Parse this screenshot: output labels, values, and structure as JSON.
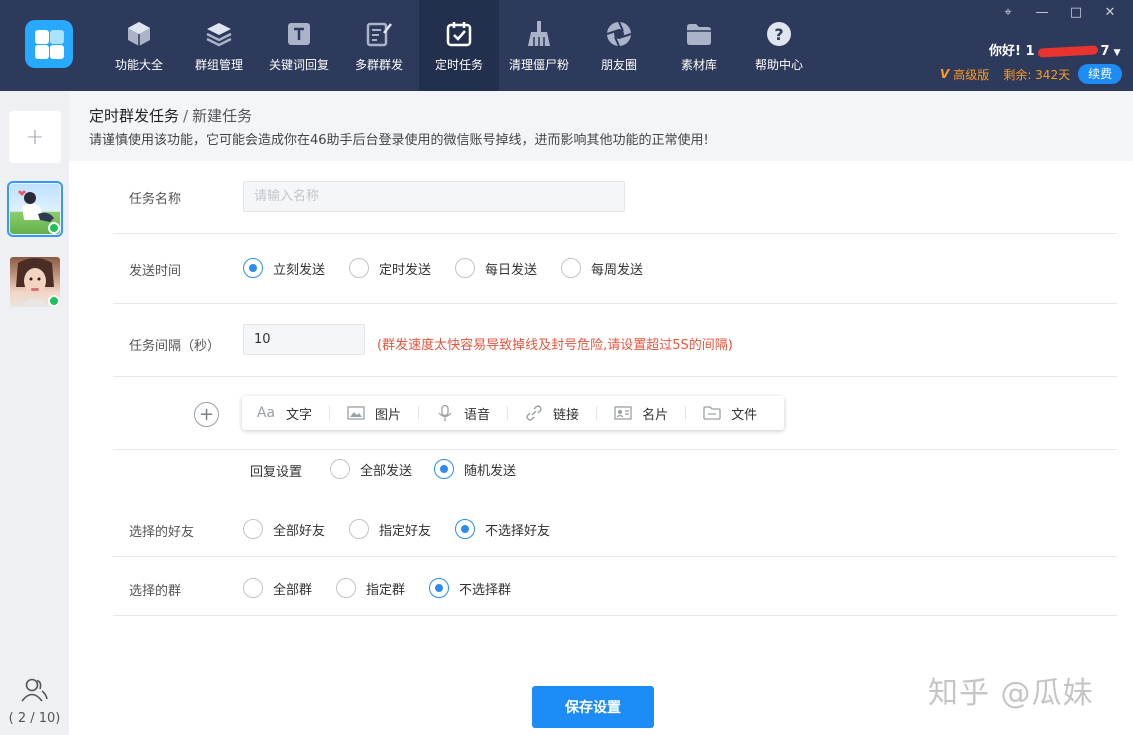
{
  "nav": {
    "items": [
      {
        "label": "功能大全",
        "icon": "cube-icon"
      },
      {
        "label": "群组管理",
        "icon": "layers-icon"
      },
      {
        "label": "关键词回复",
        "icon": "text-t-icon"
      },
      {
        "label": "多群群发",
        "icon": "edit-doc-icon"
      },
      {
        "label": "定时任务",
        "icon": "calendar-check-icon"
      },
      {
        "label": "清理僵尸粉",
        "icon": "broom-icon"
      },
      {
        "label": "朋友圈",
        "icon": "aperture-icon"
      },
      {
        "label": "素材库",
        "icon": "folder-icon"
      },
      {
        "label": "帮助中心",
        "icon": "question-icon"
      }
    ],
    "active_index": 4
  },
  "user": {
    "greeting_prefix": "你好! 1",
    "greeting_suffix": "7",
    "vip_mark": "V",
    "vip_label": "高级版",
    "remaining": "剩余: 342天",
    "renew": "续费"
  },
  "sidebar": {
    "add": "+",
    "counter": "( 2 / 10)"
  },
  "header": {
    "breadcrumb_parent": "定时群发任务",
    "breadcrumb_sep": "/",
    "breadcrumb_current": "新建任务",
    "warning": "请谨慎使用该功能，它可能会造成你在46助手后台登录使用的微信账号掉线，进而影响其他功能的正常使用!"
  },
  "form": {
    "task_name_label": "任务名称",
    "task_name_placeholder": "请输入名称",
    "task_name_value": "",
    "send_time_label": "发送时间",
    "send_time_options": [
      "立刻发送",
      "定时发送",
      "每日发送",
      "每周发送"
    ],
    "send_time_selected": "立刻发送",
    "interval_label": "任务间隔（秒）",
    "interval_value": "10",
    "interval_warning": "(群发速度太快容易导致掉线及封号危险,请设置超过5S的间隔)",
    "content_tools": [
      {
        "label": "文字",
        "icon": "font-aa-icon"
      },
      {
        "label": "图片",
        "icon": "image-icon"
      },
      {
        "label": "语音",
        "icon": "microphone-icon"
      },
      {
        "label": "链接",
        "icon": "link-icon"
      },
      {
        "label": "名片",
        "icon": "card-icon"
      },
      {
        "label": "文件",
        "icon": "file-icon"
      }
    ],
    "reply_label": "回复设置",
    "reply_options": [
      "全部发送",
      "随机发送"
    ],
    "reply_selected": "随机发送",
    "friends_label": "选择的好友",
    "friends_options": [
      "全部好友",
      "指定好友",
      "不选择好友"
    ],
    "friends_selected": "不选择好友",
    "groups_label": "选择的群",
    "groups_options": [
      "全部群",
      "指定群",
      "不选择群"
    ],
    "groups_selected": "不选择群",
    "save": "保存设置"
  },
  "watermark": "知乎 @瓜妹",
  "colors": {
    "topbar": "#2e3a5b",
    "accent": "#1e8cf5",
    "warning_red": "#e8553c",
    "vip_orange": "#ff9a1f"
  }
}
